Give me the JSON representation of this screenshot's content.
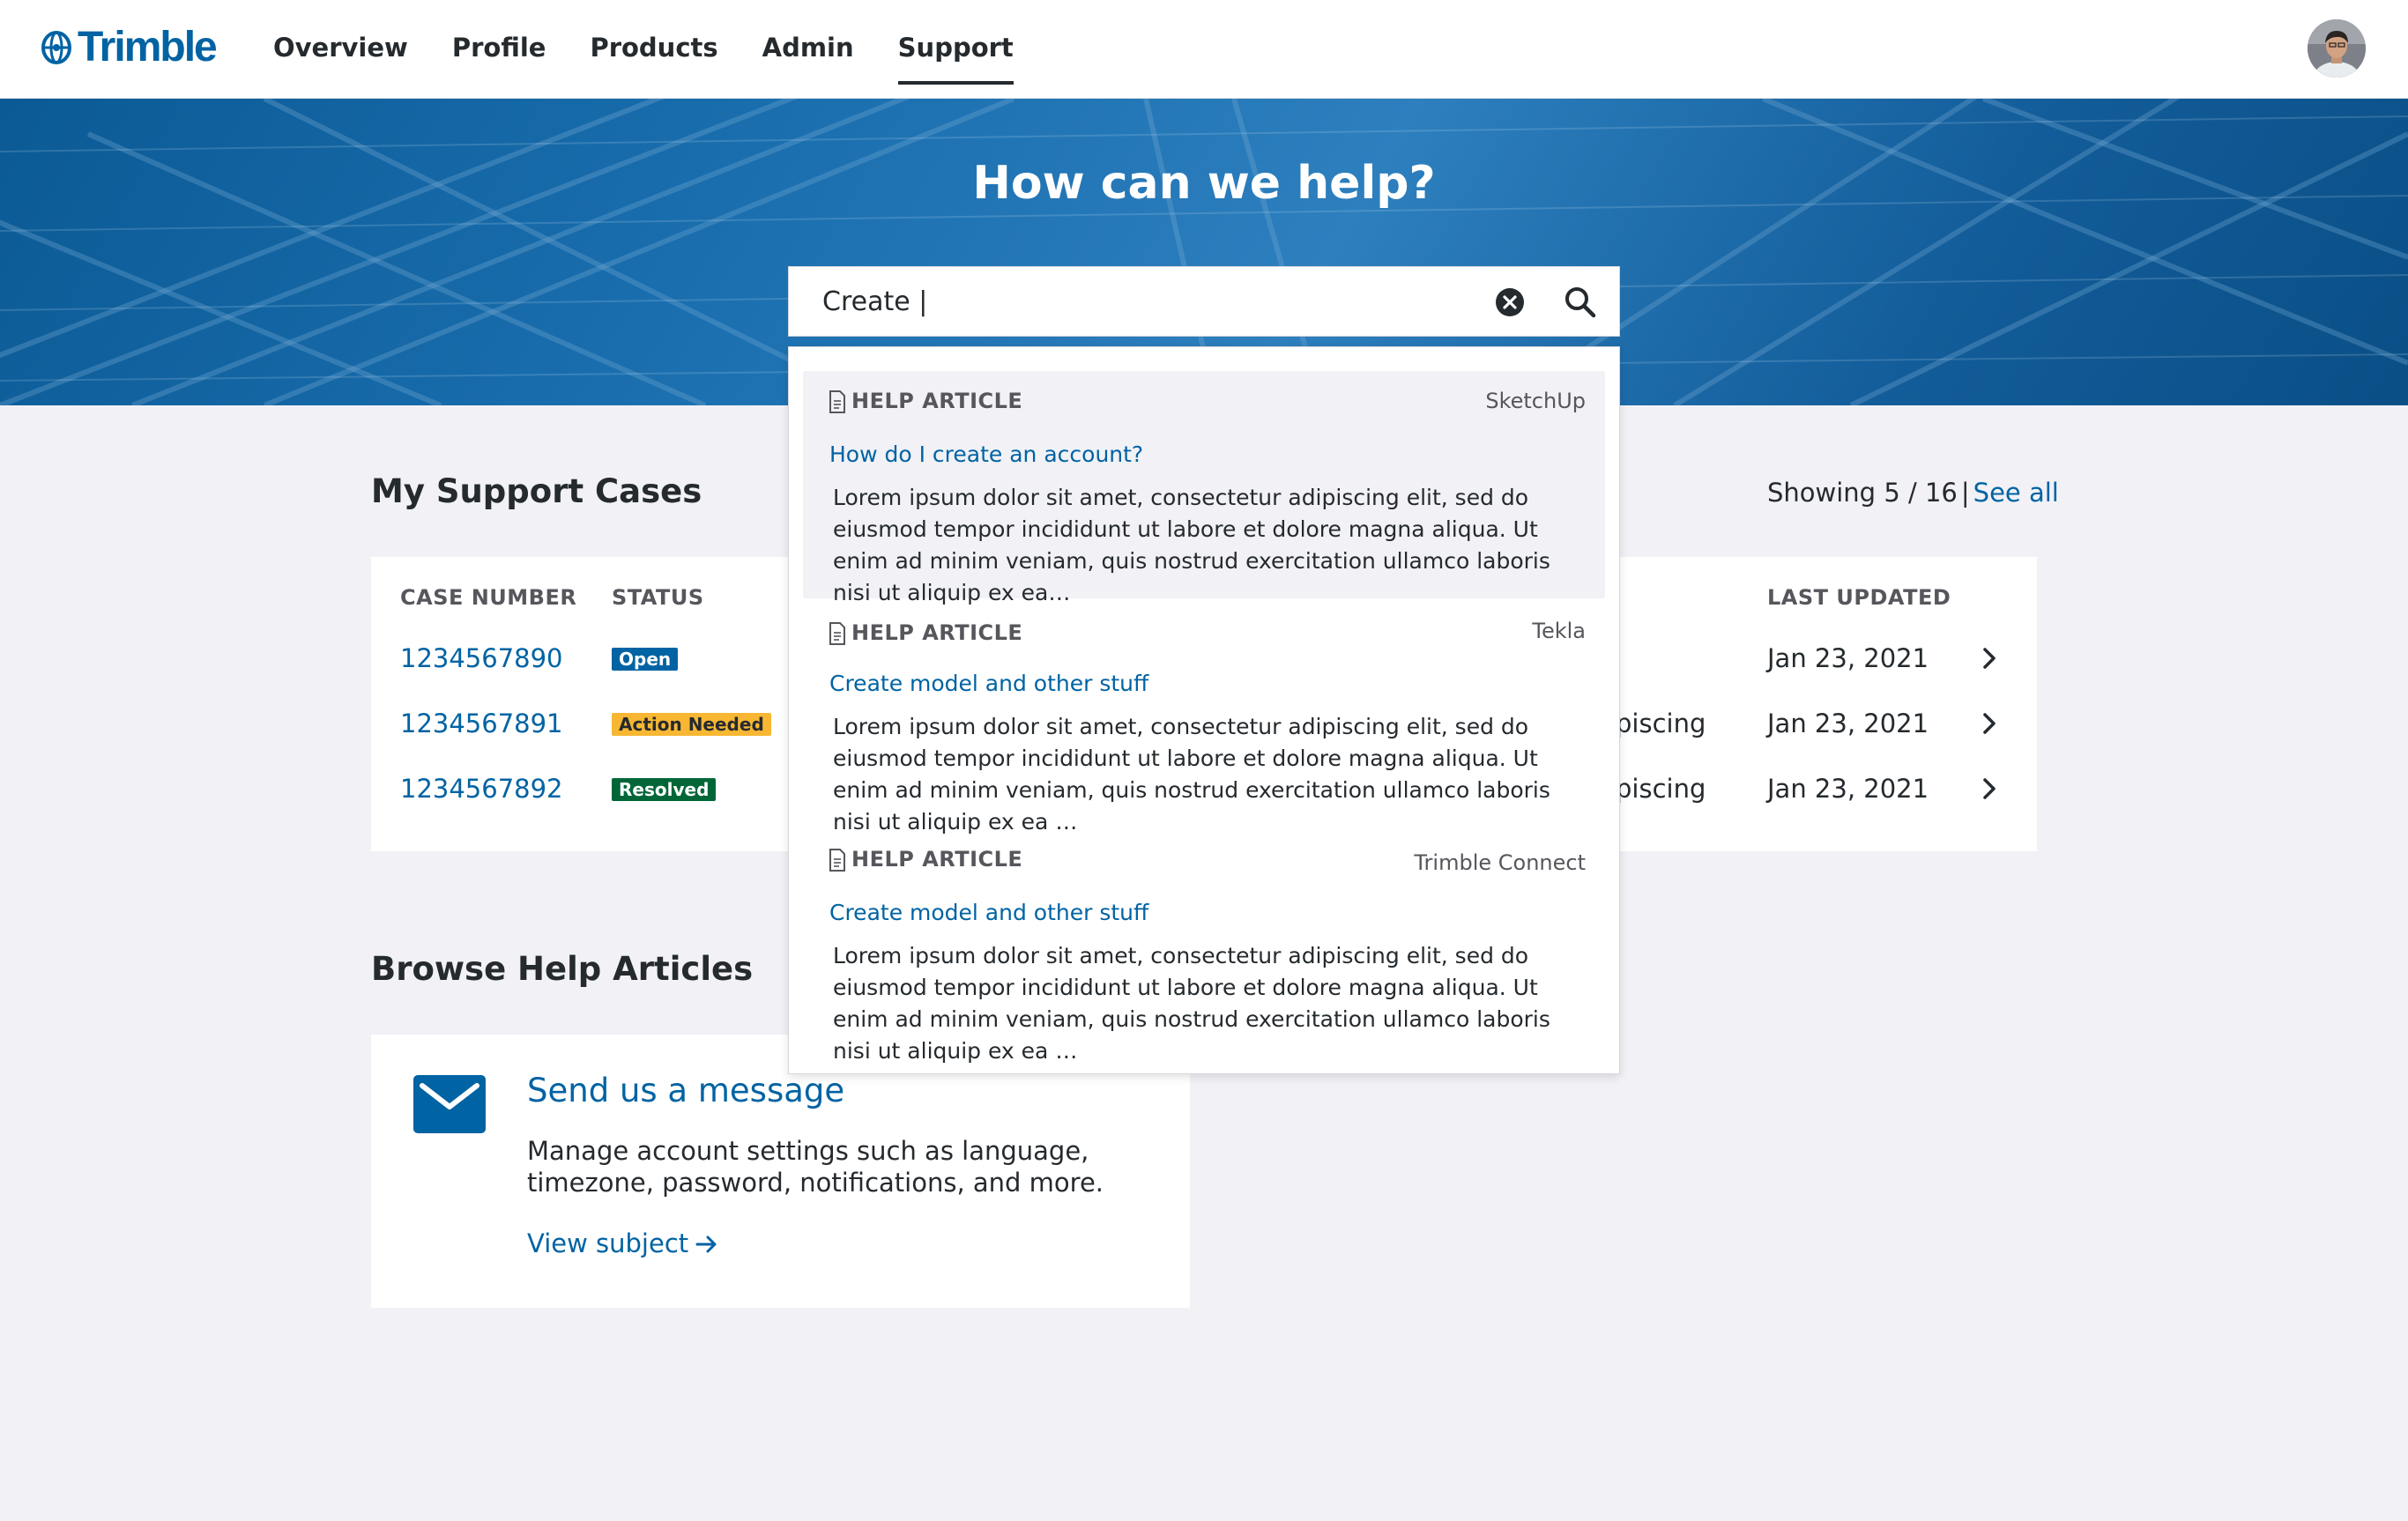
{
  "brand": {
    "name": "Trimble",
    "color": "#0063a3"
  },
  "nav": {
    "items": [
      "Overview",
      "Profile",
      "Products",
      "Admin",
      "Support"
    ],
    "active": "Support"
  },
  "user": {
    "avatar_icon": "user-avatar"
  },
  "hero": {
    "title": "How can we help?",
    "search": {
      "value": "Create |",
      "clear_icon": "clear-circle-icon",
      "search_icon": "search-icon"
    }
  },
  "support_cases": {
    "title": "My Support Cases",
    "showing": "Showing 5 / 16",
    "separator": "|",
    "see_all": "See all",
    "columns": {
      "case_number": "CASE NUMBER",
      "status": "STATUS",
      "last_updated": "LAST UPDATED"
    },
    "rows": [
      {
        "case_number": "1234567890",
        "status": "Open",
        "description": "",
        "last_updated": "Jan 23, 2021"
      },
      {
        "case_number": "1234567891",
        "status": "Action Needed",
        "description": "piscing",
        "last_updated": "Jan 23, 2021"
      },
      {
        "case_number": "1234567892",
        "status": "Resolved",
        "description": "piscing",
        "last_updated": "Jan 23, 2021"
      }
    ]
  },
  "help_articles": {
    "title": "Browse Help Articles",
    "card": {
      "icon": "mail-icon",
      "title": "Send us a message",
      "description": "Manage account settings such as language, timezone, password, notifications, and more.",
      "link": "View subject"
    }
  },
  "search_results": [
    {
      "type": "HELP ARTICLE",
      "product": "SketchUp",
      "title": "How do I create an account?",
      "body": "Lorem ipsum dolor sit amet, consectetur adipiscing elit, sed do eiusmod tempor incididunt ut labore et dolore magna aliqua. Ut enim ad minim veniam, quis nostrud exercitation ullamco laboris nisi ut aliquip ex ea…"
    },
    {
      "type": "HELP ARTICLE",
      "product": "Tekla",
      "title": "Create model and other stuff",
      "body": "Lorem ipsum dolor sit amet, consectetur adipiscing elit, sed do eiusmod tempor incididunt ut labore et dolore magna aliqua. Ut enim ad minim veniam, quis nostrud exercitation ullamco laboris nisi ut aliquip ex ea …"
    },
    {
      "type": "HELP ARTICLE",
      "product": "Trimble Connect",
      "title": "Create model and other stuff",
      "body": "Lorem ipsum dolor sit amet, consectetur adipiscing elit, sed do eiusmod tempor incididunt ut labore et dolore magna aliqua. Ut enim ad minim veniam, quis nostrud exercitation ullamco laboris nisi ut aliquip ex ea …"
    }
  ],
  "colors": {
    "link": "#0063a3",
    "status_open": "#0063a3",
    "status_action_needed": "#f7b733",
    "status_resolved": "#006638",
    "page_background": "#f1f1f6"
  }
}
